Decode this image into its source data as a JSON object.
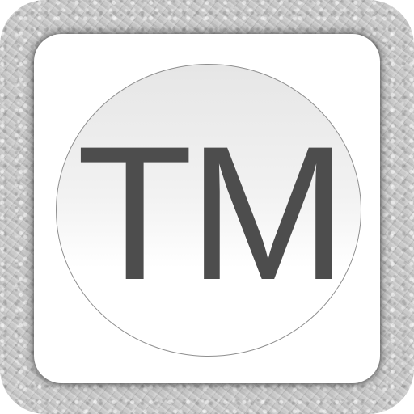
{
  "icon": {
    "name": "trademark-app-icon",
    "symbol_text": "TM",
    "colors": {
      "frame": "#c9c9c9",
      "panel": "#ffffff",
      "circle_border": "#8f8f8f",
      "text": "#4d4d4d"
    }
  }
}
